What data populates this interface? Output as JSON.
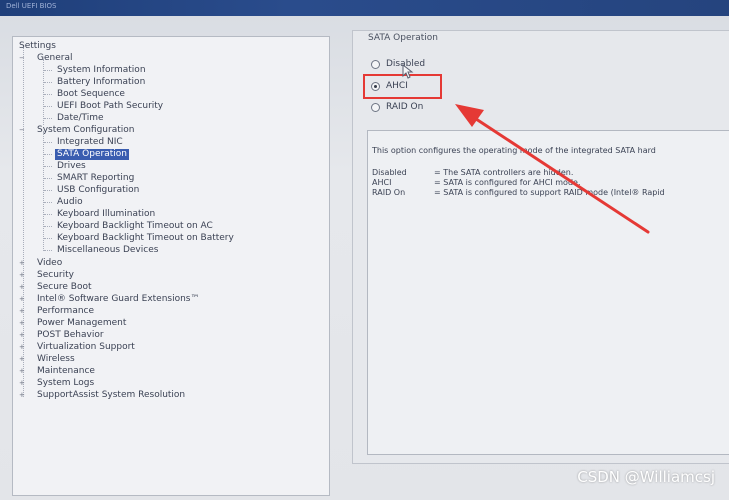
{
  "window": {
    "title": "Dell UEFI BIOS"
  },
  "tree": {
    "items": [
      {
        "label": "Settings",
        "level": 0
      },
      {
        "label": "General",
        "level": 1,
        "expanded": true
      },
      {
        "label": "System Information",
        "level": 2
      },
      {
        "label": "Battery Information",
        "level": 2
      },
      {
        "label": "Boot Sequence",
        "level": 2
      },
      {
        "label": "UEFI Boot Path Security",
        "level": 2
      },
      {
        "label": "Date/Time",
        "level": 2
      },
      {
        "label": "System Configuration",
        "level": 1,
        "expanded": true
      },
      {
        "label": "Integrated NIC",
        "level": 2
      },
      {
        "label": "SATA Operation",
        "level": 2,
        "selected": true
      },
      {
        "label": "Drives",
        "level": 2
      },
      {
        "label": "SMART Reporting",
        "level": 2
      },
      {
        "label": "USB Configuration",
        "level": 2
      },
      {
        "label": "Audio",
        "level": 2
      },
      {
        "label": "Keyboard Illumination",
        "level": 2
      },
      {
        "label": "Keyboard Backlight Timeout on AC",
        "level": 2
      },
      {
        "label": "Keyboard Backlight Timeout on Battery",
        "level": 2
      },
      {
        "label": "Miscellaneous Devices",
        "level": 2
      },
      {
        "label": "Video",
        "level": 1
      },
      {
        "label": "Security",
        "level": 1
      },
      {
        "label": "Secure Boot",
        "level": 1
      },
      {
        "label": "Intel® Software Guard Extensions™",
        "level": 1
      },
      {
        "label": "Performance",
        "level": 1
      },
      {
        "label": "Power Management",
        "level": 1
      },
      {
        "label": "POST Behavior",
        "level": 1
      },
      {
        "label": "Virtualization Support",
        "level": 1
      },
      {
        "label": "Wireless",
        "level": 1
      },
      {
        "label": "Maintenance",
        "level": 1
      },
      {
        "label": "System Logs",
        "level": 1
      },
      {
        "label": "SupportAssist System Resolution",
        "level": 1
      }
    ]
  },
  "sata": {
    "group_title": "SATA Operation",
    "options": [
      {
        "label": "Disabled",
        "selected": false
      },
      {
        "label": "AHCI",
        "selected": true
      },
      {
        "label": "RAID On",
        "selected": false
      }
    ]
  },
  "description": {
    "intro": "This option configures the operating mode of the integrated SATA hard",
    "rows": [
      {
        "key": "Disabled",
        "value": "= The SATA controllers are hidden."
      },
      {
        "key": "AHCI",
        "value": "= SATA is configured for AHCI mode."
      },
      {
        "key": "RAID On",
        "value": "= SATA is configured to support RAID mode (Intel® Rapid"
      }
    ]
  },
  "annotation": {
    "color": "#e53935"
  },
  "watermark": "CSDN @Williamcsj"
}
